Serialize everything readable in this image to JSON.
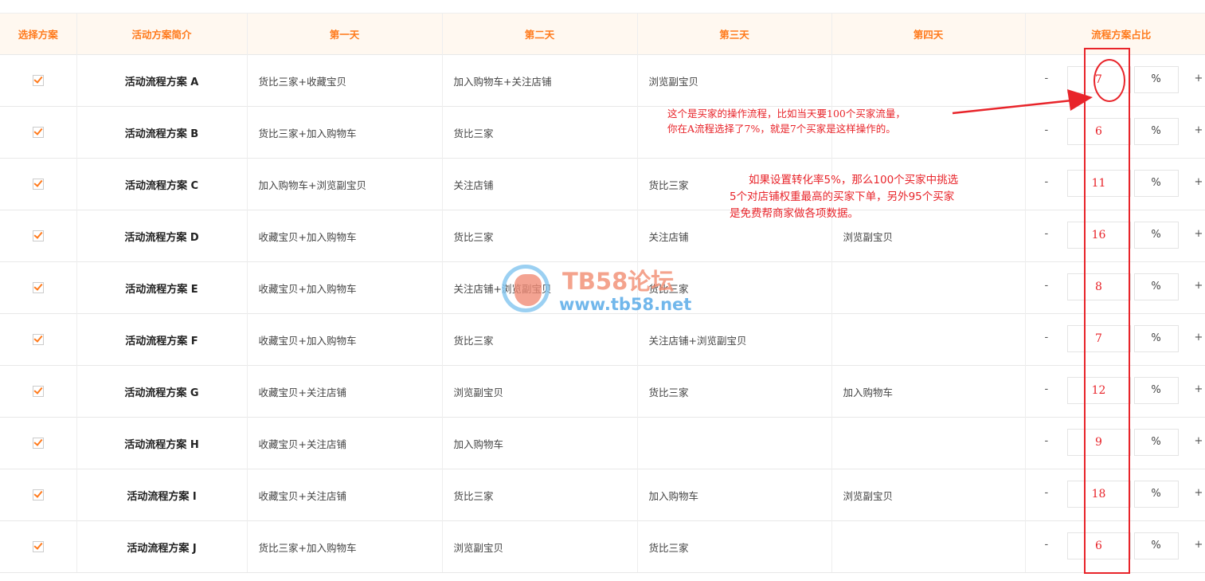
{
  "table": {
    "headers": {
      "select": "选择方案",
      "intro": "活动方案简介",
      "day1": "第一天",
      "day2": "第二天",
      "day3": "第三天",
      "day4": "第四天",
      "ratio": "流程方案占比"
    },
    "rows": [
      {
        "checked": true,
        "name": "活动流程方案 A",
        "day1": "货比三家+收藏宝贝",
        "day2": "加入购物车+关注店铺",
        "day3": "浏览副宝贝",
        "day4": "",
        "minus": "-",
        "ratio": "7",
        "unit": "%",
        "plus": "+"
      },
      {
        "checked": true,
        "name": "活动流程方案 B",
        "day1": "货比三家+加入购物车",
        "day2": "货比三家",
        "day3": "",
        "day4": "",
        "minus": "-",
        "ratio": "6",
        "unit": "%",
        "plus": "+"
      },
      {
        "checked": true,
        "name": "活动流程方案 C",
        "day1": "加入购物车+浏览副宝贝",
        "day2": "关注店铺",
        "day3": "货比三家",
        "day4": "",
        "minus": "-",
        "ratio": "11",
        "unit": "%",
        "plus": "+"
      },
      {
        "checked": true,
        "name": "活动流程方案 D",
        "day1": "收藏宝贝+加入购物车",
        "day2": "货比三家",
        "day3": "关注店铺",
        "day4": "浏览副宝贝",
        "minus": "-",
        "ratio": "16",
        "unit": "%",
        "plus": "+"
      },
      {
        "checked": true,
        "name": "活动流程方案 E",
        "day1": "收藏宝贝+加入购物车",
        "day2": "关注店铺+浏览副宝贝",
        "day3": "货比三家",
        "day4": "",
        "minus": "-",
        "ratio": "8",
        "unit": "%",
        "plus": "+"
      },
      {
        "checked": true,
        "name": "活动流程方案 F",
        "day1": "收藏宝贝+加入购物车",
        "day2": "货比三家",
        "day3": "关注店铺+浏览副宝贝",
        "day4": "",
        "minus": "-",
        "ratio": "7",
        "unit": "%",
        "plus": "+"
      },
      {
        "checked": true,
        "name": "活动流程方案 G",
        "day1": "收藏宝贝+关注店铺",
        "day2": "浏览副宝贝",
        "day3": "货比三家",
        "day4": "加入购物车",
        "minus": "-",
        "ratio": "12",
        "unit": "%",
        "plus": "+"
      },
      {
        "checked": true,
        "name": "活动流程方案 H",
        "day1": "收藏宝贝+关注店铺",
        "day2": "加入购物车",
        "day3": "",
        "day4": "",
        "minus": "-",
        "ratio": "9",
        "unit": "%",
        "plus": "+"
      },
      {
        "checked": true,
        "name": "活动流程方案 I",
        "day1": "收藏宝贝+关注店铺",
        "day2": "货比三家",
        "day3": "加入购物车",
        "day4": "浏览副宝贝",
        "minus": "-",
        "ratio": "18",
        "unit": "%",
        "plus": "+"
      },
      {
        "checked": true,
        "name": "活动流程方案 J",
        "day1": "货比三家+加入购物车",
        "day2": "浏览副宝贝",
        "day3": "货比三家",
        "day4": "",
        "minus": "-",
        "ratio": "6",
        "unit": "%",
        "plus": "+"
      }
    ]
  },
  "annotations": {
    "note1": [
      "这个是买家的操作流程，比如当天要100个买家流量，",
      "你在A流程选择了7%，就是7个买家是这样操作的。"
    ],
    "note2": [
      "如果设置转化率5%，那么100个买家中挑选",
      "5个对店铺权重最高的买家下单，另外95个买家",
      "是免费帮商家做各项数据。"
    ],
    "color": "#e8242a"
  },
  "watermark": {
    "title": "TB58论坛",
    "url": "www.tb58.net"
  },
  "colors": {
    "accent": "#ff7a1c",
    "header_bg": "#fff8f0",
    "annotation": "#e8242a"
  }
}
